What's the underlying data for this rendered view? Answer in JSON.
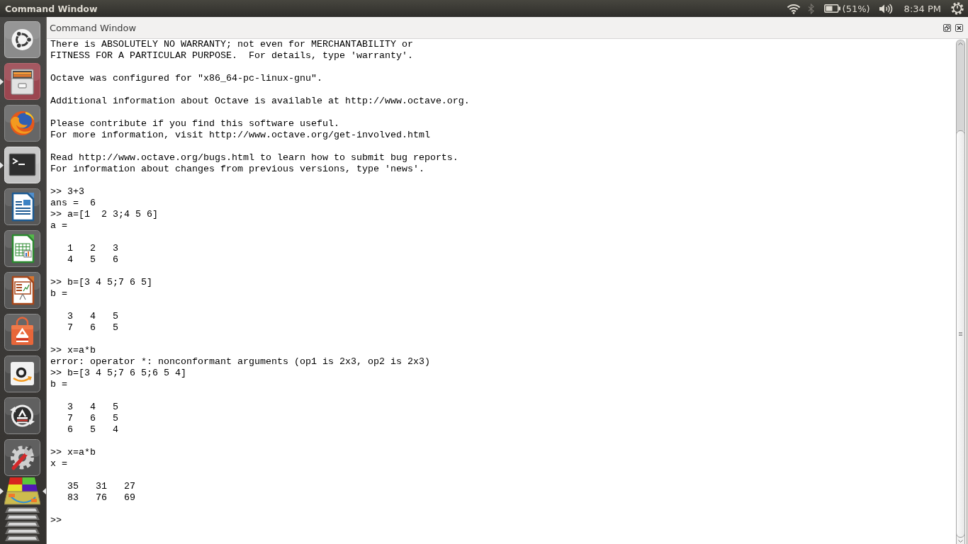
{
  "top_panel": {
    "title": "Command Window",
    "battery": "(51%)",
    "clock": "8:34 PM"
  },
  "launcher": {
    "items": [
      {
        "kind": "home",
        "running": false,
        "focused": false
      },
      {
        "kind": "files",
        "running": true,
        "focused": false
      },
      {
        "kind": "browser",
        "running": false,
        "focused": false
      },
      {
        "kind": "terminal",
        "running": true,
        "focused": false
      },
      {
        "kind": "writer",
        "running": false,
        "focused": false
      },
      {
        "kind": "calc",
        "running": false,
        "focused": false
      },
      {
        "kind": "impress",
        "running": false,
        "focused": false
      },
      {
        "kind": "software",
        "running": false,
        "focused": false
      },
      {
        "kind": "shop",
        "running": false,
        "focused": false
      },
      {
        "kind": "updater",
        "running": false,
        "focused": false
      },
      {
        "kind": "settings",
        "running": false,
        "focused": false
      },
      {
        "kind": "workspaces",
        "running": true,
        "focused": true
      },
      {
        "kind": "folded",
        "running": false,
        "focused": false
      }
    ]
  },
  "dock": {
    "title": "Command Window"
  },
  "console": {
    "blocks": [
      {
        "kind": "text",
        "lines": [
          "There is ABSOLUTELY NO WARRANTY; not even for MERCHANTABILITY or",
          "FITNESS FOR A PARTICULAR PURPOSE.  For details, type 'warranty'."
        ]
      },
      {
        "kind": "text",
        "lines": [
          "Octave was configured for \"x86_64-pc-linux-gnu\"."
        ]
      },
      {
        "kind": "text",
        "lines": [
          "Additional information about Octave is available at http://www.octave.org."
        ]
      },
      {
        "kind": "text",
        "lines": [
          "Please contribute if you find this software useful.",
          "For more information, visit http://www.octave.org/get-involved.html"
        ]
      },
      {
        "kind": "text",
        "lines": [
          "Read http://www.octave.org/bugs.html to learn how to submit bug reports.",
          "For information about changes from previous versions, type 'news'."
        ]
      },
      {
        "kind": "text",
        "lines": [
          ">> 3+3",
          "ans =  6",
          ">> a=[1  2 3;4 5 6]",
          "a ="
        ]
      },
      {
        "kind": "matrix",
        "lines": [
          "1   2   3",
          "4   5   6"
        ]
      },
      {
        "kind": "text",
        "lines": [
          ">> b=[3 4 5;7 6 5]",
          "b ="
        ]
      },
      {
        "kind": "matrix",
        "lines": [
          "3   4   5",
          "7   6   5"
        ]
      },
      {
        "kind": "text",
        "lines": [
          ">> x=a*b",
          "error: operator *: nonconformant arguments (op1 is 2x3, op2 is 2x3)",
          ">> b=[3 4 5;7 6 5;6 5 4]",
          "b ="
        ]
      },
      {
        "kind": "matrix",
        "lines": [
          "3   4   5",
          "7   6   5",
          "6   5   4"
        ]
      },
      {
        "kind": "text",
        "lines": [
          ">> x=a*b",
          "x ="
        ]
      },
      {
        "kind": "matrix",
        "lines": [
          "35   31   27",
          "83   76   69"
        ]
      },
      {
        "kind": "text",
        "lines": [
          ">>"
        ]
      }
    ]
  }
}
